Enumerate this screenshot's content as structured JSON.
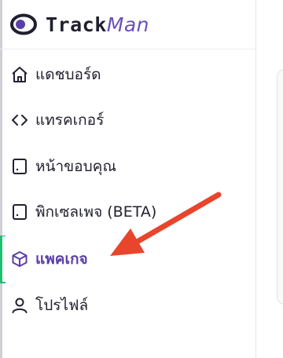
{
  "brand": {
    "logo_track": "Track",
    "logo_man": "Man",
    "accent": "#6b4fb8"
  },
  "nav": {
    "items": [
      {
        "label": "แดชบอร์ด",
        "icon": "home-icon",
        "active": false
      },
      {
        "label": "แทรคเกอร์",
        "icon": "code-icon",
        "active": false
      },
      {
        "label": "หน้าขอบคุณ",
        "icon": "tablet-icon",
        "active": false
      },
      {
        "label": "พิกเซลเพจ (BETA)",
        "icon": "tablet-icon",
        "active": false
      },
      {
        "label": "แพคเกจ",
        "icon": "package-icon",
        "active": true
      },
      {
        "label": "โปรไฟล์",
        "icon": "user-icon",
        "active": false
      }
    ]
  },
  "colors": {
    "active_indicator": "#1fbf73",
    "annotation_arrow": "#e8452c"
  }
}
